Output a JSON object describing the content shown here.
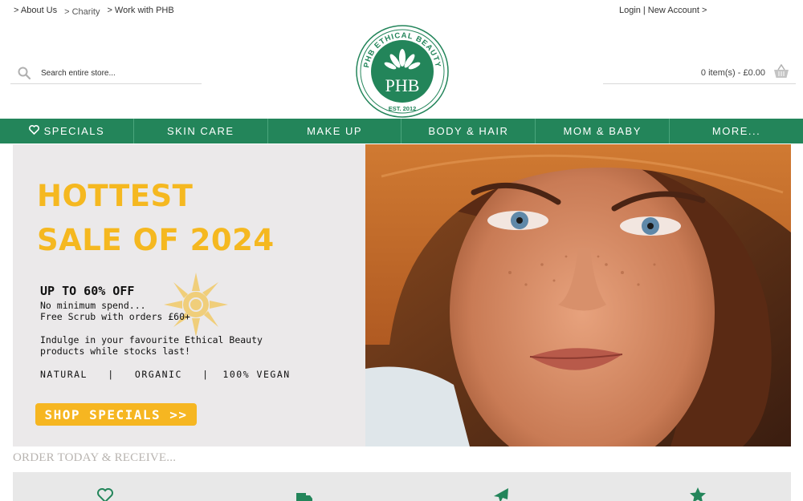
{
  "top_links": [
    {
      "label": "> About Us"
    },
    {
      "label": "> Charity"
    },
    {
      "label": "> Work with PHB"
    }
  ],
  "account": {
    "login": "Login",
    "separator": "|",
    "new_account": "New Account >"
  },
  "logo": {
    "ring_text": "PHB ETHICAL BEAUTY",
    "brand": "PHB",
    "est": "EST. 2012"
  },
  "search": {
    "placeholder": "Search entire store...",
    "icon": "search-icon"
  },
  "cart": {
    "summary": "0 item(s) - £0.00",
    "icon": "basket-icon"
  },
  "nav": {
    "items": [
      {
        "label": "SPECIALS",
        "icon": "heart-icon"
      },
      {
        "label": "SKIN CARE"
      },
      {
        "label": "MAKE UP"
      },
      {
        "label": "BODY & HAIR"
      },
      {
        "label": "MOM & BABY"
      },
      {
        "label": "MORE..."
      }
    ]
  },
  "hero": {
    "headline_line1": "HOTTEST",
    "headline_line2": "SALE OF 2024",
    "offer_title": "UP TO 60% OFF",
    "offer_line1": "No minimum spend...",
    "offer_line2": "Free Scrub with orders £60+",
    "body_line1": "Indulge in your favourite Ethical Beauty",
    "body_line2": "products while stocks last!",
    "badges": "NATURAL   |   ORGANIC   |  100% VEGAN",
    "cta": "SHOP SPECIALS >>"
  },
  "order_today": {
    "heading": "ORDER TODAY & RECEIVE...",
    "icons": [
      "heart-outline-icon",
      "truck-icon",
      "plane-icon",
      "star-icon"
    ]
  },
  "colors": {
    "brand_green": "#23855a",
    "accent_yellow": "#f5b820",
    "hero_bg": "#ebe9ea"
  }
}
